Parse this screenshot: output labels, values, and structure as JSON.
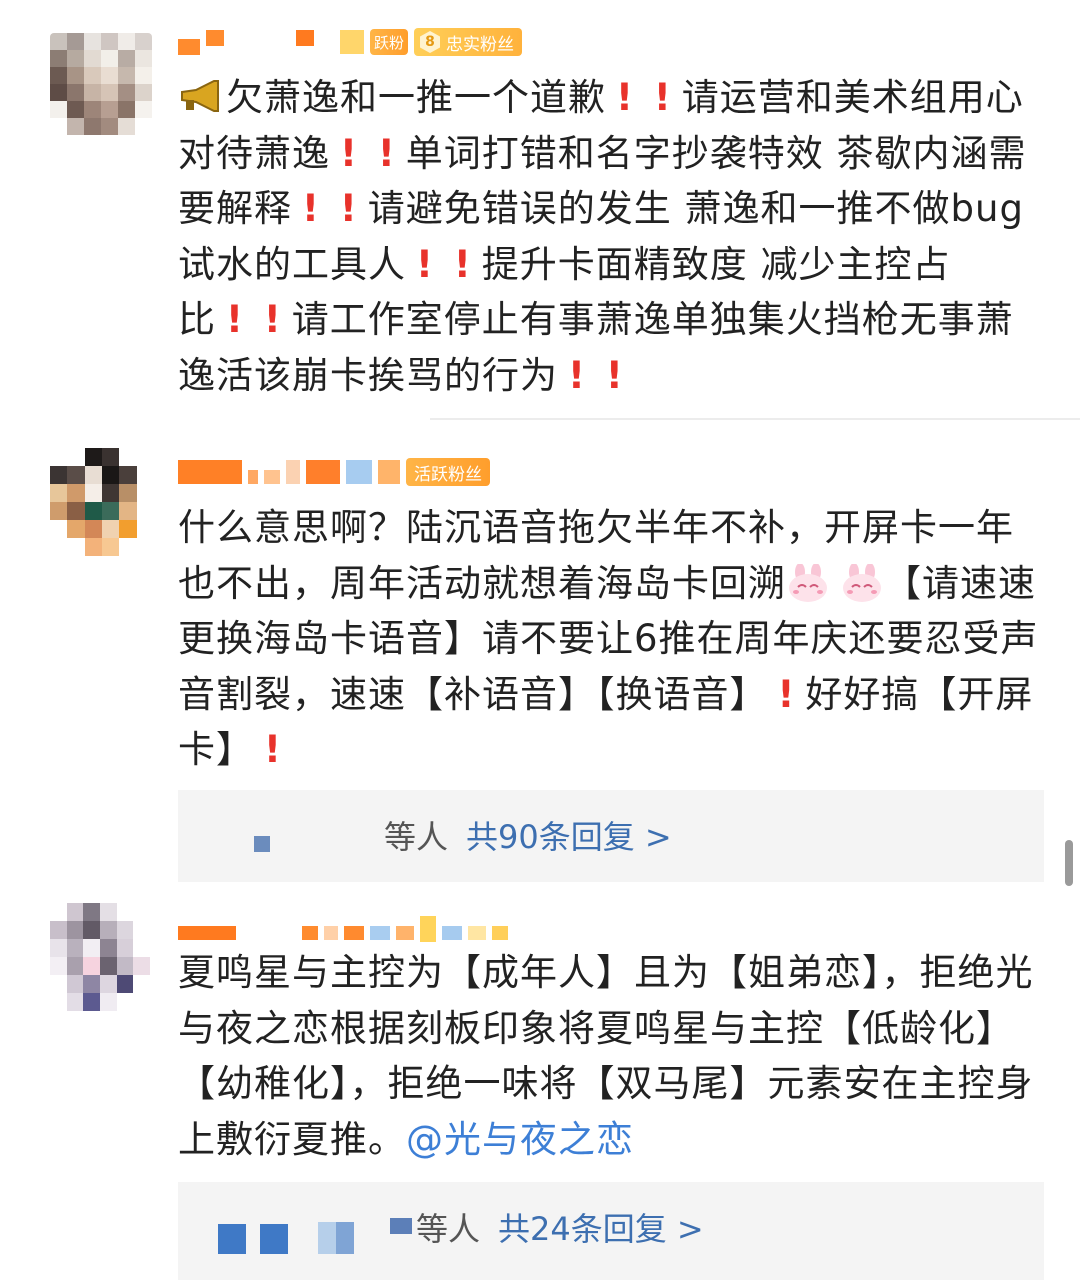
{
  "comments": [
    {
      "badge_secondary": "跃粉",
      "badge_loyal_level": "8",
      "badge_loyal_label": "忠实粉丝",
      "text_parts": [
        "欠萧逸和一推一个道歉",
        "请运营和美术组用心对待萧逸",
        "单词打错和名字抄袭特效 茶歇内涵需要解释",
        "请避免错误的发生 萧逸和一推不做bug试水的工具人",
        "提升卡面精致度 减少主控占比",
        "请工作室停止有事萧逸单独集火挡枪无事萧逸活该崩卡挨骂的行为"
      ]
    },
    {
      "badge": "活跃粉丝",
      "text_parts": [
        "什么意思啊？陆沉语音拖欠半年不补，开屏卡一年也不出，周年活动就想着海岛卡回溯",
        "【请速速更换海岛卡语音】请不要让6推在周年庆还要忍受声音割裂，速速【补语音】【换语音】",
        "好好搞【开屏卡】"
      ],
      "reply_summary": "等人",
      "reply_link": "共90条回复 >"
    },
    {
      "text": "夏鸣星与主控为【成年人】且为【姐弟恋】，拒绝光与夜之恋根据刻板印象将夏鸣星与主控【低龄化】【幼稚化】，拒绝一味将【双马尾】元素安在主控身上敷衍夏推。",
      "mention": "@光与夜之恋",
      "reply_summary": "等人",
      "reply_link": "共24条回复 >"
    }
  ],
  "icons": {
    "megaphone": "megaphone-icon",
    "exclamation": "red-exclamation-icon",
    "bunny": "bunny-emoji-icon"
  },
  "colors": {
    "exclamation": "#e8322b",
    "link": "#3d6fb0",
    "mention": "#3d7fd6",
    "badge_orange": "#ffa83a"
  }
}
